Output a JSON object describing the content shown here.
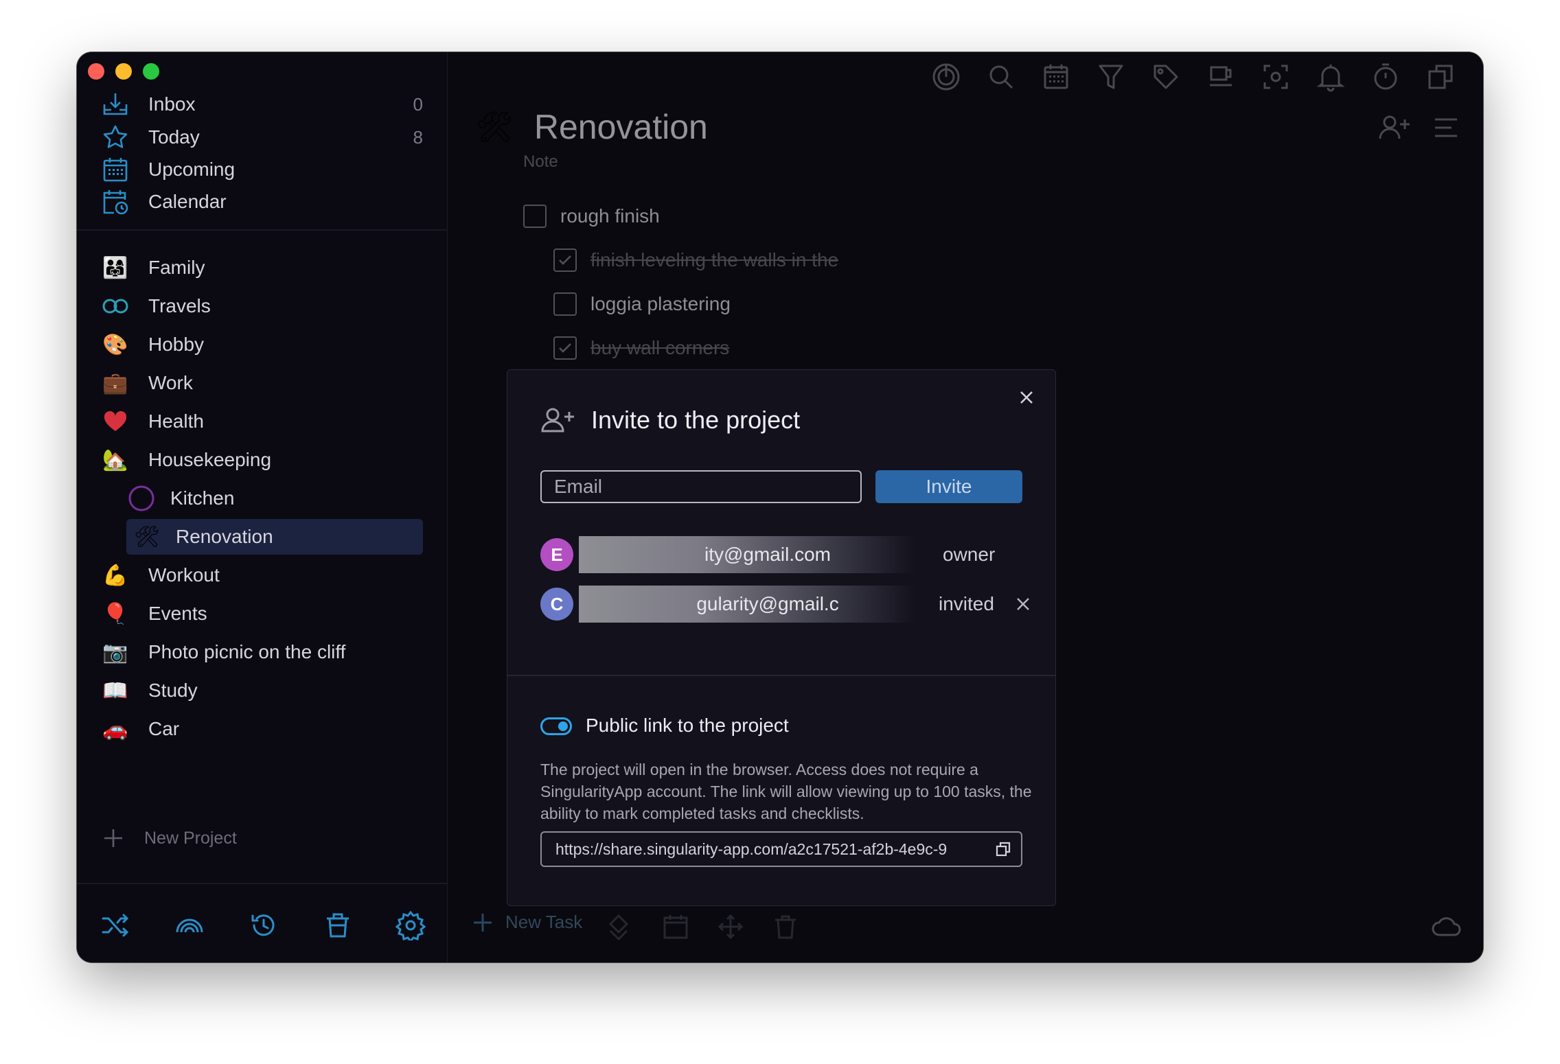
{
  "sidebar": {
    "nav": [
      {
        "label": "Inbox",
        "count": "0",
        "icon": "inbox-icon"
      },
      {
        "label": "Today",
        "count": "8",
        "icon": "star-icon"
      },
      {
        "label": "Upcoming",
        "count": "",
        "icon": "calendar-grid-icon"
      },
      {
        "label": "Calendar",
        "count": "",
        "icon": "calendar-clock-icon"
      }
    ],
    "projects": [
      {
        "label": "Family",
        "emoji": "👨‍👩‍👧"
      },
      {
        "label": "Travels",
        "emoji": "∞"
      },
      {
        "label": "Hobby",
        "emoji": "🎨"
      },
      {
        "label": "Work",
        "emoji": "💼"
      },
      {
        "label": "Health",
        "emoji": "❤️"
      },
      {
        "label": "Housekeeping",
        "emoji": "🏡"
      },
      {
        "label": "Kitchen",
        "emoji": "○"
      },
      {
        "label": "Renovation",
        "emoji": "🛠"
      },
      {
        "label": "Workout",
        "emoji": "💪"
      },
      {
        "label": "Events",
        "emoji": "🎈"
      },
      {
        "label": "Photo picnic on the cliff",
        "emoji": "📷"
      },
      {
        "label": "Study",
        "emoji": "📖"
      },
      {
        "label": "Car",
        "emoji": "🚗"
      }
    ],
    "new_project_label": "New Project"
  },
  "main": {
    "title": "Renovation",
    "note": "Note",
    "tasks": [
      {
        "text": "rough finish",
        "done": false
      },
      {
        "text": "finish leveling the walls in the",
        "done": true
      },
      {
        "text": "loggia plastering",
        "done": false
      },
      {
        "text": "buy wall corners",
        "done": true
      }
    ],
    "new_task_label": "New Task"
  },
  "modal": {
    "title": "Invite to the project",
    "email_placeholder": "Email",
    "invite_label": "Invite",
    "members": [
      {
        "initial": "E",
        "email": "ity@gmail.com",
        "role": "owner",
        "color": "#b34fc2"
      },
      {
        "initial": "C",
        "email": "gularity@gmail.c",
        "role": "invited",
        "color": "#6a78c8"
      }
    ],
    "public_link_title": "Public link to the project",
    "public_link_desc": "The project will open in the browser. Access does not require a SingularityApp account. The link will allow viewing up to 100 tasks, the ability to mark completed tasks and checklists.",
    "public_link_url": "https://share.singularity-app.com/a2c17521-af2b-4e9c-9"
  },
  "colors": {
    "accent": "#2b66a6",
    "icon_blue": "#2a8fc9",
    "selected_bg": "#1b2340"
  }
}
